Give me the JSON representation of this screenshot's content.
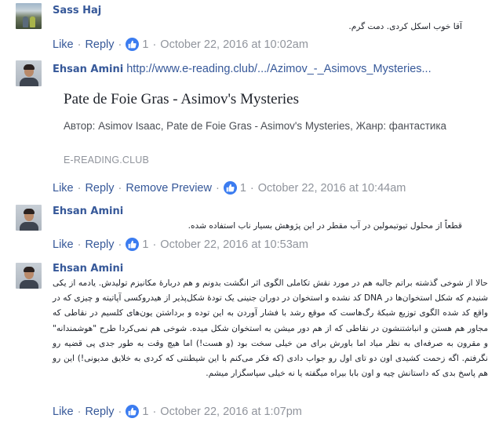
{
  "actions": {
    "like": "Like",
    "reply": "Reply",
    "remove_preview": "Remove Preview",
    "separator": "·"
  },
  "comments": [
    {
      "author": "Sass Haj",
      "text": "آقا خوب اسکل کردی. دمت گرم.",
      "likes": "1",
      "timestamp": "October 22, 2016 at 10:02am"
    },
    {
      "author": "Ehsan Amini",
      "link": "http://www.e-reading.club/.../Azimov_-_Asimovs_Mysteries...",
      "preview": {
        "title": "Pate de Foie Gras - Asimov's Mysteries",
        "description": "Автор: Asimov Isaac, Pate de Foie Gras - Asimov's Mysteries, Жанр: фантастика",
        "domain": "E-READING.CLUB"
      },
      "likes": "1",
      "timestamp": "October 22, 2016 at 10:44am"
    },
    {
      "author": "Ehsan Amini",
      "text": "قطعاً از محلول تیوتیمولین در آب مقطر در این پژوهش بسیار ناب استفاده شده.",
      "likes": "1",
      "timestamp": "October 22, 2016 at 10:53am"
    },
    {
      "author": "Ehsan Amini",
      "text": "حالا از شوخی گذشته براتم جالبه هم در مورد نقش تکاملی الگوی اثر انگشت بدونم و هم دربارهٔ مکانیزم تولیدش. یادمه از یکی شنیدم که شکل استخوان‌ها در DNA کد نشده و استخوان در دوران جنینی یک تودهٔ شکل‌پذیر از هیدروکسی آپاتیته و چیزی که در واقع کد شده الگوی توزیع شبکهٔ رگ‌هاست که موقع رشد با فشار آوردن به این توده و برداشتن یون‌های کلسیم در نقاطی که مجاور هم هستن و انباشتنشون در نقاطی که از هم دور میشن به استخوان شکل میده. شوخی هم نمی‌کردا طرح \"هوشمندانه\" و مقرون به صرفه‌ای به نظر میاد اما باورش برای من خیلی سخت بود (و هست!) اما هیچ وقت به طور جدی پی قضیه رو نگرفتم. اگه زحمت کشیدی اون دو تای اول رو جواب دادی (که فکر می‌کنم با این شیطنتی که کردی به خلایق مدیونی!) این رو هم پاسخ بدی که داستانش چیه و اون بابا بیراه میگفته یا نه خیلی سپاسگزار میشم.",
      "likes": "1",
      "timestamp": "October 22, 2016 at 1:07pm"
    }
  ]
}
